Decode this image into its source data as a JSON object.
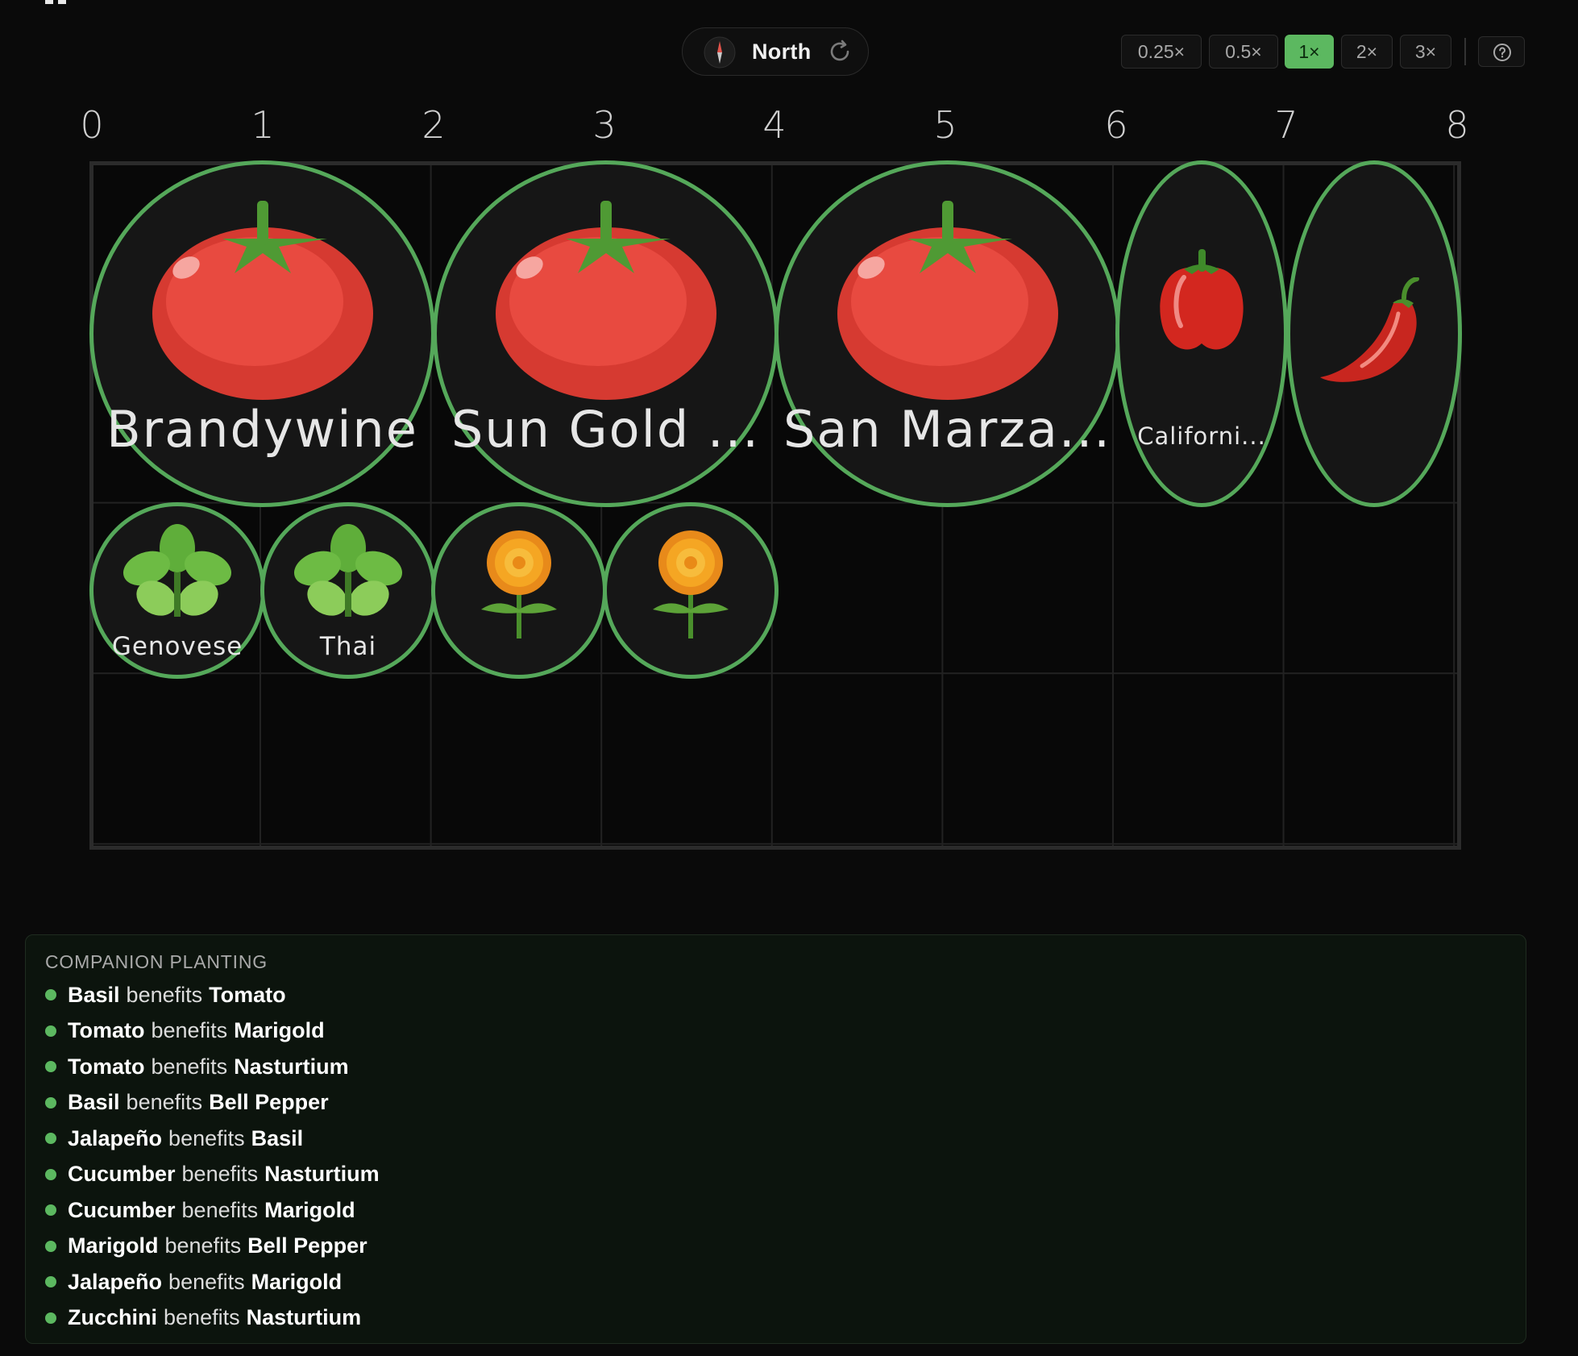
{
  "toolbar": {
    "orientation_label": "North",
    "zoom_options": [
      "0.25×",
      "0.5×",
      "1×",
      "2×",
      "3×"
    ],
    "zoom_selected": "1×",
    "accent_color": "#5cb860"
  },
  "ruler": {
    "ticks": [
      "0",
      "1",
      "2",
      "3",
      "4",
      "5",
      "6",
      "7",
      "8"
    ]
  },
  "plants": [
    {
      "icon": "tomato",
      "label": "Brandywine"
    },
    {
      "icon": "tomato",
      "label": "Sun Gold ..."
    },
    {
      "icon": "tomato",
      "label": "San Marza..."
    },
    {
      "icon": "bell-pepper",
      "label": "Californi..."
    },
    {
      "icon": "chili-pepper",
      "label": ""
    },
    {
      "icon": "basil",
      "label": "Genovese"
    },
    {
      "icon": "basil",
      "label": "Thai"
    },
    {
      "icon": "marigold",
      "label": ""
    },
    {
      "icon": "marigold",
      "label": ""
    }
  ],
  "companion": {
    "title": "COMPANION PLANTING",
    "verb": "benefits",
    "pairs": [
      {
        "a": "Basil",
        "b": "Tomato"
      },
      {
        "a": "Tomato",
        "b": "Marigold"
      },
      {
        "a": "Tomato",
        "b": "Nasturtium"
      },
      {
        "a": "Basil",
        "b": "Bell Pepper"
      },
      {
        "a": "Jalapeño",
        "b": "Basil"
      },
      {
        "a": "Cucumber",
        "b": "Nasturtium"
      },
      {
        "a": "Cucumber",
        "b": "Marigold"
      },
      {
        "a": "Marigold",
        "b": "Bell Pepper"
      },
      {
        "a": "Jalapeño",
        "b": "Marigold"
      },
      {
        "a": "Zucchini",
        "b": "Nasturtium"
      }
    ]
  }
}
